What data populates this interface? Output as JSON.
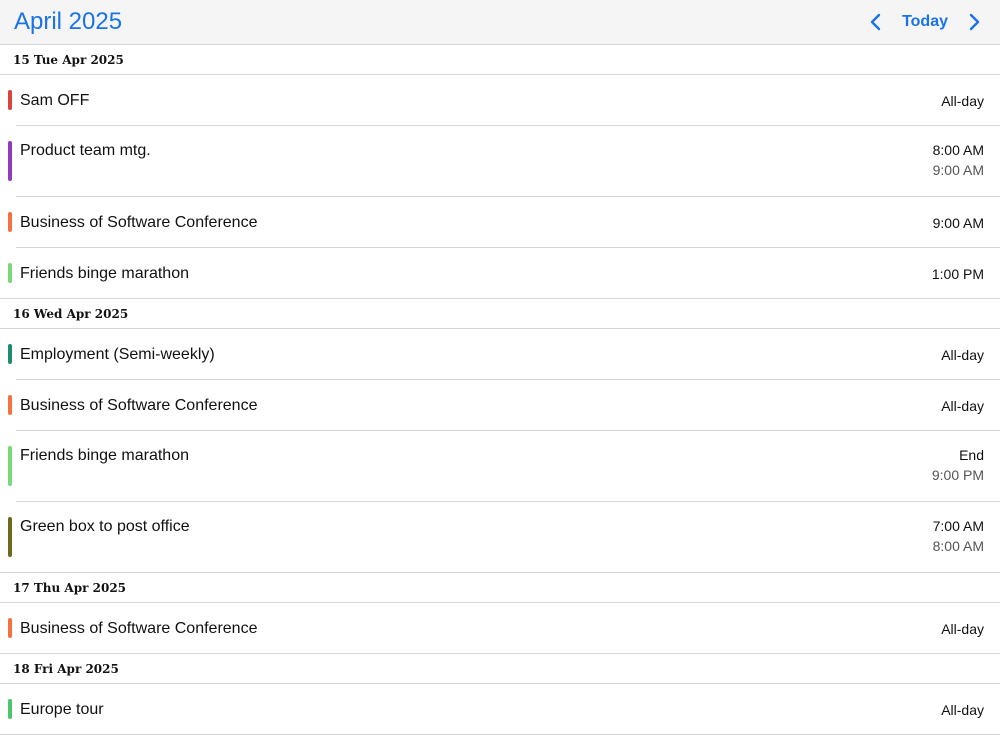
{
  "header": {
    "title": "April 2025",
    "today_label": "Today",
    "prev_icon": "chevron-left-icon",
    "next_icon": "chevron-right-icon",
    "accent_color": "#1a73e8"
  },
  "days": [
    {
      "label": "15 Tue Apr 2025",
      "events": [
        {
          "title": "Sam OFF",
          "start": "All-day",
          "end": "",
          "color": "#d9453c"
        },
        {
          "title": "Product team mtg.",
          "start": "8:00 AM",
          "end": "9:00 AM",
          "color": "#8e3cb8"
        },
        {
          "title": "Business of Software Conference",
          "start": "9:00 AM",
          "end": "",
          "color": "#f4723f"
        },
        {
          "title": "Friends binge marathon",
          "start": "1:00 PM",
          "end": "",
          "color": "#7cd67c"
        }
      ]
    },
    {
      "label": "16 Wed Apr 2025",
      "events": [
        {
          "title": "Employment (Semi-weekly)",
          "start": "All-day",
          "end": "",
          "color": "#1f8a70"
        },
        {
          "title": "Business of Software Conference",
          "start": "All-day",
          "end": "",
          "color": "#f4723f"
        },
        {
          "title": "Friends binge marathon",
          "start": "End",
          "end": "9:00 PM",
          "color": "#7cd67c"
        },
        {
          "title": "Green box to post office",
          "start": "7:00 AM",
          "end": "8:00 AM",
          "color": "#6b6b1f"
        }
      ]
    },
    {
      "label": "17 Thu Apr 2025",
      "events": [
        {
          "title": "Business of Software Conference",
          "start": "All-day",
          "end": "",
          "color": "#f4723f"
        }
      ]
    },
    {
      "label": "18 Fri Apr 2025",
      "events": [
        {
          "title": "Europe tour",
          "start": "All-day",
          "end": "",
          "color": "#4cc46a"
        }
      ]
    }
  ]
}
